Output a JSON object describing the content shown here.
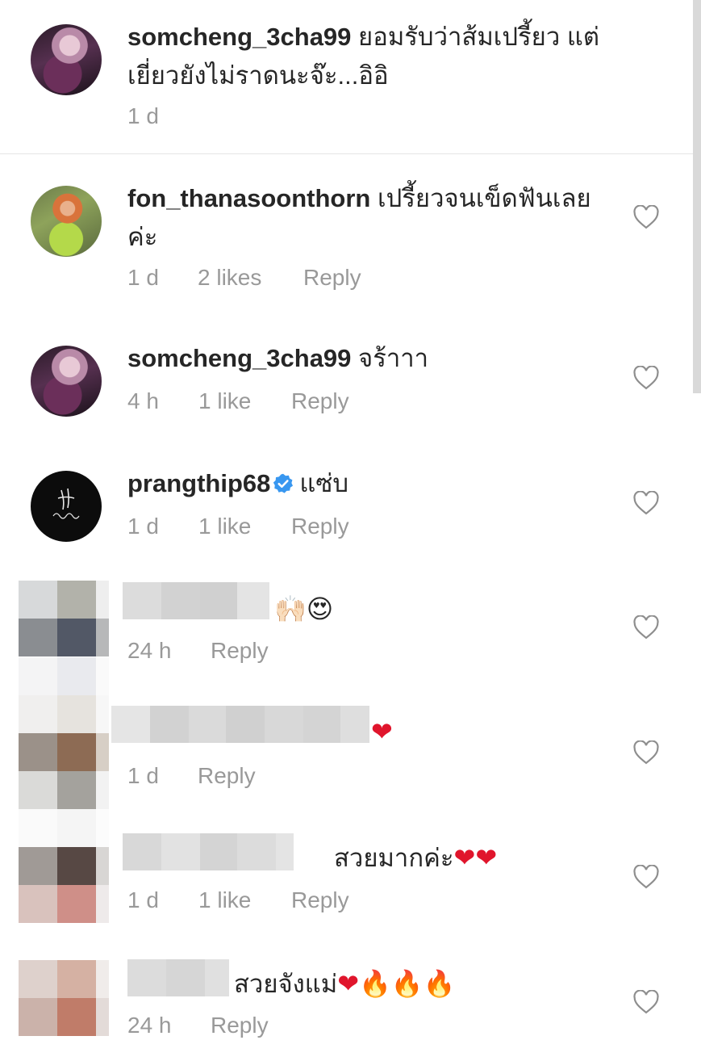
{
  "comments": [
    {
      "username": "somcheng_3cha99",
      "text_line1": "ยอมรับว่าส้มเปรี้ยว แต่",
      "text_line2": "เยี่ยวยังไม่ราดนะจ๊ะ...อิอิ",
      "time": "1 d"
    },
    {
      "username": "fon_thanasoonthorn",
      "text_line1": "เปรี้ยวจนเข็ดฟันเลย",
      "text_line2": "ค่ะ",
      "time": "1 d",
      "likes": "2 likes",
      "reply": "Reply"
    },
    {
      "username": "somcheng_3cha99",
      "text": "จร้าาา",
      "time": "4 h",
      "likes": "1 like",
      "reply": "Reply"
    },
    {
      "username": "prangthip68",
      "verified": true,
      "text": "แซ่บ",
      "time": "1 d",
      "likes": "1 like",
      "reply": "Reply"
    },
    {
      "username_hidden": true,
      "emoji": "🙌🏻😍",
      "time": "24 h",
      "reply": "Reply"
    },
    {
      "username_hidden": true,
      "emoji": "❤",
      "time": "1 d",
      "reply": "Reply"
    },
    {
      "username_hidden": true,
      "text": "สวยมากค่ะ",
      "emoji": "❤❤",
      "time": "1 d",
      "likes": "1 like",
      "reply": "Reply"
    },
    {
      "username_hidden": true,
      "text": "สวยจังแม่",
      "emoji": "❤🔥🔥🔥",
      "time": "24 h",
      "reply": "Reply"
    }
  ],
  "icons": {
    "like": "heart-outline-icon",
    "verified": "verified-badge-icon"
  },
  "colors": {
    "text": "#262626",
    "meta": "#999999",
    "verified": "#3897f0",
    "divider": "#e6e6e6"
  }
}
